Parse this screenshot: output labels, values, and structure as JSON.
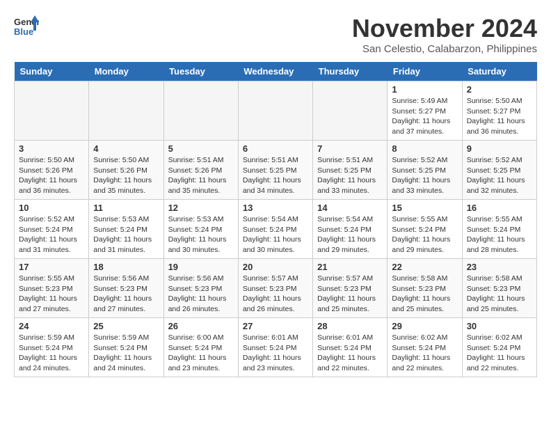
{
  "logo": {
    "general": "General",
    "blue": "Blue"
  },
  "title": "November 2024",
  "location": "San Celestio, Calabarzon, Philippines",
  "weekdays": [
    "Sunday",
    "Monday",
    "Tuesday",
    "Wednesday",
    "Thursday",
    "Friday",
    "Saturday"
  ],
  "weeks": [
    [
      {
        "day": "",
        "info": ""
      },
      {
        "day": "",
        "info": ""
      },
      {
        "day": "",
        "info": ""
      },
      {
        "day": "",
        "info": ""
      },
      {
        "day": "",
        "info": ""
      },
      {
        "day": "1",
        "info": "Sunrise: 5:49 AM\nSunset: 5:27 PM\nDaylight: 11 hours and 37 minutes."
      },
      {
        "day": "2",
        "info": "Sunrise: 5:50 AM\nSunset: 5:27 PM\nDaylight: 11 hours and 36 minutes."
      }
    ],
    [
      {
        "day": "3",
        "info": "Sunrise: 5:50 AM\nSunset: 5:26 PM\nDaylight: 11 hours and 36 minutes."
      },
      {
        "day": "4",
        "info": "Sunrise: 5:50 AM\nSunset: 5:26 PM\nDaylight: 11 hours and 35 minutes."
      },
      {
        "day": "5",
        "info": "Sunrise: 5:51 AM\nSunset: 5:26 PM\nDaylight: 11 hours and 35 minutes."
      },
      {
        "day": "6",
        "info": "Sunrise: 5:51 AM\nSunset: 5:25 PM\nDaylight: 11 hours and 34 minutes."
      },
      {
        "day": "7",
        "info": "Sunrise: 5:51 AM\nSunset: 5:25 PM\nDaylight: 11 hours and 33 minutes."
      },
      {
        "day": "8",
        "info": "Sunrise: 5:52 AM\nSunset: 5:25 PM\nDaylight: 11 hours and 33 minutes."
      },
      {
        "day": "9",
        "info": "Sunrise: 5:52 AM\nSunset: 5:25 PM\nDaylight: 11 hours and 32 minutes."
      }
    ],
    [
      {
        "day": "10",
        "info": "Sunrise: 5:52 AM\nSunset: 5:24 PM\nDaylight: 11 hours and 31 minutes."
      },
      {
        "day": "11",
        "info": "Sunrise: 5:53 AM\nSunset: 5:24 PM\nDaylight: 11 hours and 31 minutes."
      },
      {
        "day": "12",
        "info": "Sunrise: 5:53 AM\nSunset: 5:24 PM\nDaylight: 11 hours and 30 minutes."
      },
      {
        "day": "13",
        "info": "Sunrise: 5:54 AM\nSunset: 5:24 PM\nDaylight: 11 hours and 30 minutes."
      },
      {
        "day": "14",
        "info": "Sunrise: 5:54 AM\nSunset: 5:24 PM\nDaylight: 11 hours and 29 minutes."
      },
      {
        "day": "15",
        "info": "Sunrise: 5:55 AM\nSunset: 5:24 PM\nDaylight: 11 hours and 29 minutes."
      },
      {
        "day": "16",
        "info": "Sunrise: 5:55 AM\nSunset: 5:24 PM\nDaylight: 11 hours and 28 minutes."
      }
    ],
    [
      {
        "day": "17",
        "info": "Sunrise: 5:55 AM\nSunset: 5:23 PM\nDaylight: 11 hours and 27 minutes."
      },
      {
        "day": "18",
        "info": "Sunrise: 5:56 AM\nSunset: 5:23 PM\nDaylight: 11 hours and 27 minutes."
      },
      {
        "day": "19",
        "info": "Sunrise: 5:56 AM\nSunset: 5:23 PM\nDaylight: 11 hours and 26 minutes."
      },
      {
        "day": "20",
        "info": "Sunrise: 5:57 AM\nSunset: 5:23 PM\nDaylight: 11 hours and 26 minutes."
      },
      {
        "day": "21",
        "info": "Sunrise: 5:57 AM\nSunset: 5:23 PM\nDaylight: 11 hours and 25 minutes."
      },
      {
        "day": "22",
        "info": "Sunrise: 5:58 AM\nSunset: 5:23 PM\nDaylight: 11 hours and 25 minutes."
      },
      {
        "day": "23",
        "info": "Sunrise: 5:58 AM\nSunset: 5:23 PM\nDaylight: 11 hours and 25 minutes."
      }
    ],
    [
      {
        "day": "24",
        "info": "Sunrise: 5:59 AM\nSunset: 5:24 PM\nDaylight: 11 hours and 24 minutes."
      },
      {
        "day": "25",
        "info": "Sunrise: 5:59 AM\nSunset: 5:24 PM\nDaylight: 11 hours and 24 minutes."
      },
      {
        "day": "26",
        "info": "Sunrise: 6:00 AM\nSunset: 5:24 PM\nDaylight: 11 hours and 23 minutes."
      },
      {
        "day": "27",
        "info": "Sunrise: 6:01 AM\nSunset: 5:24 PM\nDaylight: 11 hours and 23 minutes."
      },
      {
        "day": "28",
        "info": "Sunrise: 6:01 AM\nSunset: 5:24 PM\nDaylight: 11 hours and 22 minutes."
      },
      {
        "day": "29",
        "info": "Sunrise: 6:02 AM\nSunset: 5:24 PM\nDaylight: 11 hours and 22 minutes."
      },
      {
        "day": "30",
        "info": "Sunrise: 6:02 AM\nSunset: 5:24 PM\nDaylight: 11 hours and 22 minutes."
      }
    ]
  ]
}
